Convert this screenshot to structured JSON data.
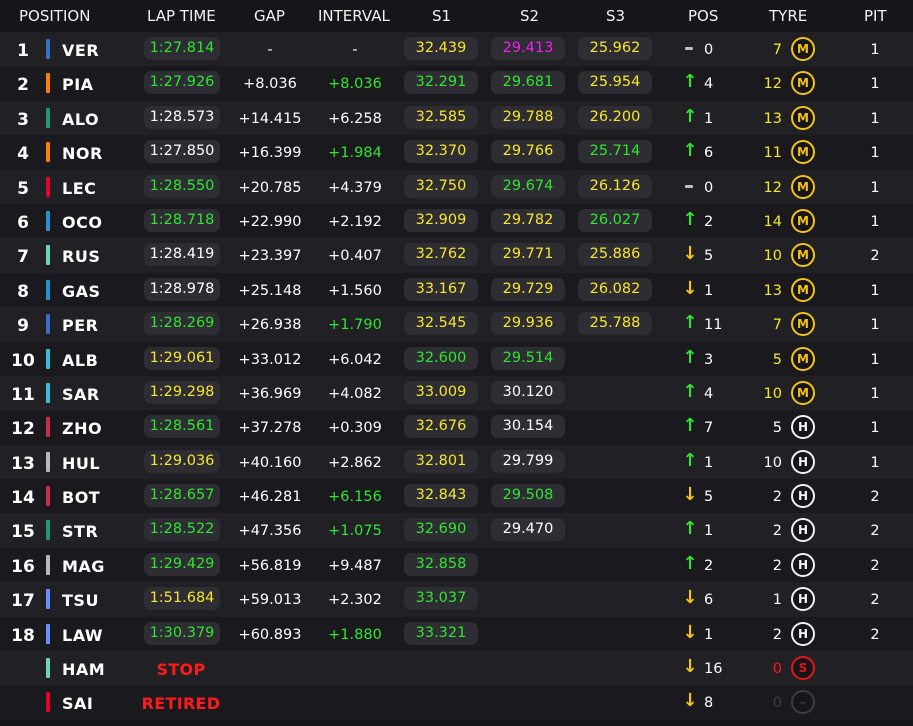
{
  "colors": {
    "purple": "#ee22ee",
    "green": "#2ee62e",
    "yellow": "#f7e629",
    "white": "#ffffff",
    "red": "#ff1a1a",
    "arrow_up": "#2ee62e",
    "arrow_down": "#f5c313",
    "tyre_medium": "#f5c313",
    "tyre_hard": "#f2f2f2",
    "tyre_soft": "#e8141c",
    "tyre_out": "#3c3c42"
  },
  "headers": {
    "position": "POSITION",
    "lap_time": "LAP TIME",
    "gap": "GAP",
    "interval": "INTERVAL",
    "s1": "S1",
    "s2": "S2",
    "s3": "S3",
    "pos": "POS",
    "tyre": "TYRE",
    "pit": "PIT"
  },
  "rows": [
    {
      "pos": "1",
      "team_color": "#3671c6",
      "code": "VER",
      "lap_time": "1:27.814",
      "lap_color": "green",
      "gap": "-",
      "interval": "-",
      "interval_color": "white",
      "s1": "32.439",
      "s1_color": "yellow",
      "s2": "29.413",
      "s2_color": "purple",
      "s3": "25.962",
      "s3_color": "yellow",
      "change": "none",
      "pos_change": "0",
      "laps": "7",
      "laps_color": "yellow",
      "tyre": "M",
      "tyre_icon": "medium-tyre-icon",
      "pit": "1"
    },
    {
      "pos": "2",
      "team_color": "#ff8000",
      "code": "PIA",
      "lap_time": "1:27.926",
      "lap_color": "green",
      "gap": "+8.036",
      "interval": "+8.036",
      "interval_color": "green",
      "s1": "32.291",
      "s1_color": "green",
      "s2": "29.681",
      "s2_color": "green",
      "s3": "25.954",
      "s3_color": "yellow",
      "change": "up",
      "pos_change": "4",
      "laps": "12",
      "laps_color": "yellow",
      "tyre": "M",
      "tyre_icon": "medium-tyre-icon",
      "pit": "1"
    },
    {
      "pos": "3",
      "team_color": "#229971",
      "code": "ALO",
      "lap_time": "1:28.573",
      "lap_color": "white",
      "gap": "+14.415",
      "interval": "+6.258",
      "interval_color": "white",
      "s1": "32.585",
      "s1_color": "yellow",
      "s2": "29.788",
      "s2_color": "yellow",
      "s3": "26.200",
      "s3_color": "yellow",
      "change": "up",
      "pos_change": "1",
      "laps": "13",
      "laps_color": "yellow",
      "tyre": "M",
      "tyre_icon": "medium-tyre-icon",
      "pit": "1"
    },
    {
      "pos": "4",
      "team_color": "#ff8000",
      "code": "NOR",
      "lap_time": "1:27.850",
      "lap_color": "white",
      "gap": "+16.399",
      "interval": "+1.984",
      "interval_color": "green",
      "s1": "32.370",
      "s1_color": "yellow",
      "s2": "29.766",
      "s2_color": "yellow",
      "s3": "25.714",
      "s3_color": "green",
      "change": "up",
      "pos_change": "6",
      "laps": "11",
      "laps_color": "yellow",
      "tyre": "M",
      "tyre_icon": "medium-tyre-icon",
      "pit": "1"
    },
    {
      "pos": "5",
      "team_color": "#e8002d",
      "code": "LEC",
      "lap_time": "1:28.550",
      "lap_color": "green",
      "gap": "+20.785",
      "interval": "+4.379",
      "interval_color": "white",
      "s1": "32.750",
      "s1_color": "yellow",
      "s2": "29.674",
      "s2_color": "green",
      "s3": "26.126",
      "s3_color": "yellow",
      "change": "none",
      "pos_change": "0",
      "laps": "12",
      "laps_color": "yellow",
      "tyre": "M",
      "tyre_icon": "medium-tyre-icon",
      "pit": "1"
    },
    {
      "pos": "6",
      "team_color": "#2293d1",
      "code": "OCO",
      "lap_time": "1:28.718",
      "lap_color": "green",
      "gap": "+22.990",
      "interval": "+2.192",
      "interval_color": "white",
      "s1": "32.909",
      "s1_color": "yellow",
      "s2": "29.782",
      "s2_color": "yellow",
      "s3": "26.027",
      "s3_color": "green",
      "change": "up",
      "pos_change": "2",
      "laps": "14",
      "laps_color": "yellow",
      "tyre": "M",
      "tyre_icon": "medium-tyre-icon",
      "pit": "1"
    },
    {
      "pos": "7",
      "team_color": "#6cd3bf",
      "code": "RUS",
      "lap_time": "1:28.419",
      "lap_color": "white",
      "gap": "+23.397",
      "interval": "+0.407",
      "interval_color": "white",
      "s1": "32.762",
      "s1_color": "yellow",
      "s2": "29.771",
      "s2_color": "yellow",
      "s3": "25.886",
      "s3_color": "yellow",
      "change": "down",
      "pos_change": "5",
      "laps": "10",
      "laps_color": "yellow",
      "tyre": "M",
      "tyre_icon": "medium-tyre-icon",
      "pit": "2"
    },
    {
      "pos": "8",
      "team_color": "#2293d1",
      "code": "GAS",
      "lap_time": "1:28.978",
      "lap_color": "white",
      "gap": "+25.148",
      "interval": "+1.560",
      "interval_color": "white",
      "s1": "33.167",
      "s1_color": "yellow",
      "s2": "29.729",
      "s2_color": "yellow",
      "s3": "26.082",
      "s3_color": "yellow",
      "change": "down",
      "pos_change": "1",
      "laps": "13",
      "laps_color": "yellow",
      "tyre": "M",
      "tyre_icon": "medium-tyre-icon",
      "pit": "1"
    },
    {
      "pos": "9",
      "team_color": "#3671c6",
      "code": "PER",
      "lap_time": "1:28.269",
      "lap_color": "green",
      "gap": "+26.938",
      "interval": "+1.790",
      "interval_color": "green",
      "s1": "32.545",
      "s1_color": "yellow",
      "s2": "29.936",
      "s2_color": "yellow",
      "s3": "25.788",
      "s3_color": "yellow",
      "change": "up",
      "pos_change": "11",
      "laps": "7",
      "laps_color": "yellow",
      "tyre": "M",
      "tyre_icon": "medium-tyre-icon",
      "pit": "1"
    },
    {
      "pos": "10",
      "team_color": "#37bedd",
      "code": "ALB",
      "lap_time": "1:29.061",
      "lap_color": "yellow",
      "gap": "+33.012",
      "interval": "+6.042",
      "interval_color": "white",
      "s1": "32.600",
      "s1_color": "green",
      "s2": "29.514",
      "s2_color": "green",
      "s3": "",
      "s3_color": "yellow",
      "change": "up",
      "pos_change": "3",
      "laps": "5",
      "laps_color": "yellow",
      "tyre": "M",
      "tyre_icon": "medium-tyre-icon",
      "pit": "1"
    },
    {
      "pos": "11",
      "team_color": "#37bedd",
      "code": "SAR",
      "lap_time": "1:29.298",
      "lap_color": "yellow",
      "gap": "+36.969",
      "interval": "+4.082",
      "interval_color": "white",
      "s1": "33.009",
      "s1_color": "yellow",
      "s2": "30.120",
      "s2_color": "white",
      "s3": "",
      "s3_color": "yellow",
      "change": "up",
      "pos_change": "4",
      "laps": "10",
      "laps_color": "yellow",
      "tyre": "M",
      "tyre_icon": "medium-tyre-icon",
      "pit": "1"
    },
    {
      "pos": "12",
      "team_color": "#c92d4b",
      "code": "ZHO",
      "lap_time": "1:28.561",
      "lap_color": "green",
      "gap": "+37.278",
      "interval": "+0.309",
      "interval_color": "white",
      "s1": "32.676",
      "s1_color": "yellow",
      "s2": "30.154",
      "s2_color": "white",
      "s3": "",
      "s3_color": "yellow",
      "change": "up",
      "pos_change": "7",
      "laps": "5",
      "laps_color": "white",
      "tyre": "H",
      "tyre_icon": "hard-tyre-icon",
      "pit": "1"
    },
    {
      "pos": "13",
      "team_color": "#b6babd",
      "code": "HUL",
      "lap_time": "1:29.036",
      "lap_color": "yellow",
      "gap": "+40.160",
      "interval": "+2.862",
      "interval_color": "white",
      "s1": "32.801",
      "s1_color": "yellow",
      "s2": "29.799",
      "s2_color": "white",
      "s3": "",
      "s3_color": "yellow",
      "change": "up",
      "pos_change": "1",
      "laps": "10",
      "laps_color": "white",
      "tyre": "H",
      "tyre_icon": "hard-tyre-icon",
      "pit": "1"
    },
    {
      "pos": "14",
      "team_color": "#c92d4b",
      "code": "BOT",
      "lap_time": "1:28.657",
      "lap_color": "green",
      "gap": "+46.281",
      "interval": "+6.156",
      "interval_color": "green",
      "s1": "32.843",
      "s1_color": "yellow",
      "s2": "29.508",
      "s2_color": "green",
      "s3": "",
      "s3_color": "yellow",
      "change": "down",
      "pos_change": "5",
      "laps": "2",
      "laps_color": "white",
      "tyre": "H",
      "tyre_icon": "hard-tyre-icon",
      "pit": "2"
    },
    {
      "pos": "15",
      "team_color": "#229971",
      "code": "STR",
      "lap_time": "1:28.522",
      "lap_color": "green",
      "gap": "+47.356",
      "interval": "+1.075",
      "interval_color": "green",
      "s1": "32.690",
      "s1_color": "green",
      "s2": "29.470",
      "s2_color": "white",
      "s3": "",
      "s3_color": "yellow",
      "change": "up",
      "pos_change": "1",
      "laps": "2",
      "laps_color": "white",
      "tyre": "H",
      "tyre_icon": "hard-tyre-icon",
      "pit": "2"
    },
    {
      "pos": "16",
      "team_color": "#b6babd",
      "code": "MAG",
      "lap_time": "1:29.429",
      "lap_color": "green",
      "gap": "+56.819",
      "interval": "+9.487",
      "interval_color": "white",
      "s1": "32.858",
      "s1_color": "green",
      "s2": "",
      "s2_color": "white",
      "s3": "",
      "s3_color": "yellow",
      "change": "up",
      "pos_change": "2",
      "laps": "2",
      "laps_color": "white",
      "tyre": "H",
      "tyre_icon": "hard-tyre-icon",
      "pit": "2"
    },
    {
      "pos": "17",
      "team_color": "#6692ff",
      "code": "TSU",
      "lap_time": "1:51.684",
      "lap_color": "yellow",
      "gap": "+59.013",
      "interval": "+2.302",
      "interval_color": "white",
      "s1": "33.037",
      "s1_color": "green",
      "s2": "",
      "s2_color": "white",
      "s3": "",
      "s3_color": "yellow",
      "change": "down",
      "pos_change": "6",
      "laps": "1",
      "laps_color": "white",
      "tyre": "H",
      "tyre_icon": "hard-tyre-icon",
      "pit": "2"
    },
    {
      "pos": "18",
      "team_color": "#6692ff",
      "code": "LAW",
      "lap_time": "1:30.379",
      "lap_color": "green",
      "gap": "+60.893",
      "interval": "+1.880",
      "interval_color": "green",
      "s1": "33.321",
      "s1_color": "green",
      "s2": "",
      "s2_color": "white",
      "s3": "",
      "s3_color": "yellow",
      "change": "down",
      "pos_change": "1",
      "laps": "2",
      "laps_color": "white",
      "tyre": "H",
      "tyre_icon": "hard-tyre-icon",
      "pit": "2"
    },
    {
      "pos": "",
      "team_color": "#6cd3bf",
      "code": "HAM",
      "status": "STOP",
      "change": "down",
      "pos_change": "16",
      "laps": "0",
      "laps_color": "red",
      "tyre": "S",
      "tyre_icon": "soft-tyre-icon",
      "pit": ""
    },
    {
      "pos": "",
      "team_color": "#e8002d",
      "code": "SAI",
      "status": "RETIRED",
      "change": "down",
      "pos_change": "8",
      "laps": "0",
      "laps_color": "dim",
      "tyre": "–",
      "tyre_icon": "retired-tyre-icon",
      "pit": ""
    }
  ]
}
